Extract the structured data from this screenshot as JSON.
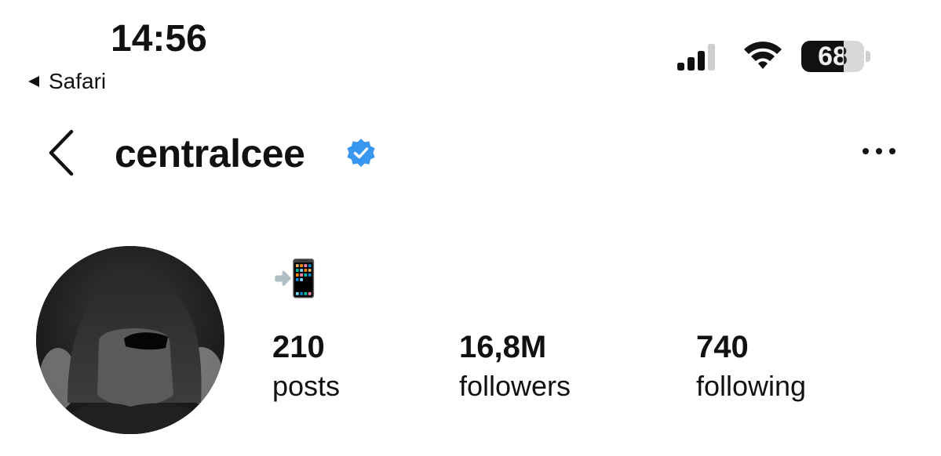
{
  "status_bar": {
    "time": "14:56",
    "back_app_label": "Safari",
    "battery_percent": "68",
    "battery_level": 0.68,
    "icons": [
      "back-triangle-icon",
      "cellular-signal-icon",
      "wifi-icon",
      "battery-icon"
    ]
  },
  "header": {
    "username": "centralcee",
    "verified": true,
    "icons": [
      "back-chevron-icon",
      "verified-badge-icon",
      "more-options-icon"
    ],
    "verified_color": "#3897f0"
  },
  "profile": {
    "bio_emoji": "📲",
    "stats": {
      "posts_count": "210",
      "posts_label": "posts",
      "followers_count": "16,8M",
      "followers_label": "followers",
      "following_count": "740",
      "following_label": "following"
    }
  }
}
